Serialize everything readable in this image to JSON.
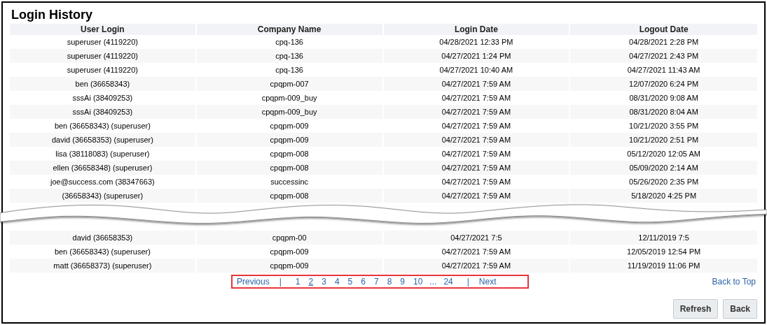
{
  "title": "Login History",
  "table": {
    "columns": [
      "User Login",
      "Company Name",
      "Login Date",
      "Logout Date"
    ],
    "rows": [
      [
        "superuser (4119220)",
        "cpq-136",
        "04/28/2021 12:33 PM",
        "04/28/2021 2:28 PM"
      ],
      [
        "superuser (4119220)",
        "cpq-136",
        "04/27/2021 1:24 PM",
        "04/27/2021 2:43 PM"
      ],
      [
        "superuser (4119220)",
        "cpq-136",
        "04/27/2021 10:40 AM",
        "04/27/2021 11:43 AM"
      ],
      [
        "ben (36658343)",
        "cpqpm-007",
        "04/27/2021 7:59 AM",
        "12/07/2020 6:24 PM"
      ],
      [
        "sssAi (38409253)",
        "cpqpm-009_buy",
        "04/27/2021 7:59 AM",
        "08/31/2020 9:08 AM"
      ],
      [
        "sssAi (38409253)",
        "cpqpm-009_buy",
        "04/27/2021 7:59 AM",
        "08/31/2020 8:04 AM"
      ],
      [
        "ben (36658343) (superuser)",
        "cpqpm-009",
        "04/27/2021 7:59 AM",
        "10/21/2020 3:55 PM"
      ],
      [
        "david (36658353) (superuser)",
        "cpqpm-009",
        "04/27/2021 7:59 AM",
        "10/21/2020 2:51 PM"
      ],
      [
        "lisa (38118083) (superuser)",
        "cpqpm-008",
        "04/27/2021 7:59 AM",
        "05/12/2020 12:05 AM"
      ],
      [
        "ellen (36658348) (superuser)",
        "cpqpm-008",
        "04/27/2021 7:59 AM",
        "05/09/2020 2:14 AM"
      ],
      [
        "joe@success.com (38347663)",
        "successinc",
        "04/27/2021 7:59 AM",
        "05/26/2020 2:35 PM"
      ],
      [
        "(36658343) (superuser)",
        "cpqpm-008",
        "04/27/2021 7:59 AM",
        "5/18/2020 4:25 PM"
      ]
    ],
    "rows_after_tear": [
      [
        "david (36658353)",
        "cpqpm-00",
        "04/27/2021 7:5",
        "12/11/2019 7:5"
      ],
      [
        "ben (36658343) (superuser)",
        "cpqpm-009",
        "04/27/2021 7:59 AM",
        "12/05/2019 12:54 PM"
      ],
      [
        "matt (36658373) (superuser)",
        "cpqpm-009",
        "04/27/2021 7:59 AM",
        "11/19/2019 11:06 PM"
      ]
    ]
  },
  "pagination": {
    "previous": "Previous",
    "separator_left": "|",
    "pages": [
      {
        "label": "1",
        "selected": false
      },
      {
        "label": "2",
        "selected": true
      },
      {
        "label": "3",
        "selected": false
      },
      {
        "label": "4",
        "selected": false
      },
      {
        "label": "5",
        "selected": false
      },
      {
        "label": "6",
        "selected": false
      },
      {
        "label": "7",
        "selected": false
      },
      {
        "label": "8",
        "selected": false
      },
      {
        "label": "9",
        "selected": false
      },
      {
        "label": "10",
        "selected": false
      }
    ],
    "ellipsis": "...",
    "last": "24",
    "separator_right": "|",
    "next": "Next"
  },
  "back_to_top": "Back to Top",
  "buttons": [
    "Refresh",
    "Back"
  ]
}
